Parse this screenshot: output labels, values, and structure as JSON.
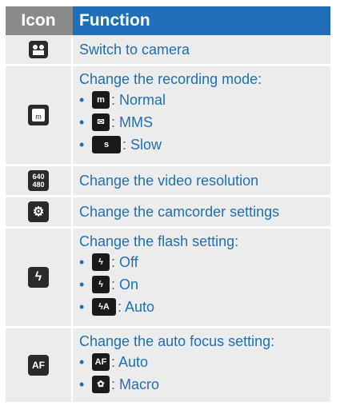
{
  "header": {
    "icon_col": "Icon",
    "function_col": "Function"
  },
  "rows": [
    {
      "function": "Switch to camera",
      "icon": "camera-switch-icon"
    },
    {
      "function": "Change the recording mode:",
      "icon": "normal-mode-icon",
      "options": [
        {
          "icon": "normal-mode-icon",
          "label": ": Normal"
        },
        {
          "icon": "mms-envelope-icon",
          "label": ": MMS"
        },
        {
          "icon": "slow-motion-icon",
          "label": ": Slow"
        }
      ]
    },
    {
      "function": "Change the video resolution",
      "icon": "resolution-icon",
      "icon_text": "640\n480"
    },
    {
      "function": "Change the camcorder settings",
      "icon": "settings-gear-icon"
    },
    {
      "function": "Change the flash setting:",
      "icon": "flash-icon",
      "options": [
        {
          "icon": "flash-off-icon",
          "label": ": Off"
        },
        {
          "icon": "flash-on-icon",
          "label": ": On"
        },
        {
          "icon": "flash-auto-icon",
          "label": ": Auto"
        }
      ]
    },
    {
      "function": "Change the auto focus setting:",
      "icon": "autofocus-icon",
      "icon_text": "AF",
      "options": [
        {
          "icon": "autofocus-auto-icon",
          "label": ": Auto",
          "icon_text": "AF"
        },
        {
          "icon": "macro-flower-icon",
          "label": ": Macro"
        }
      ]
    }
  ]
}
